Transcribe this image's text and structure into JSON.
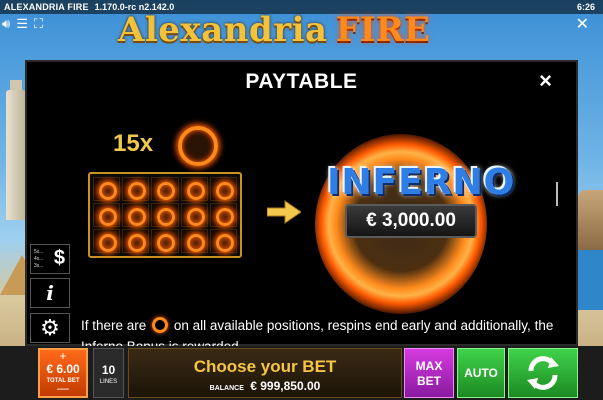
{
  "topbar": {
    "game_name": "ALEXANDRIA FIRE",
    "version": "1.170.0-rc n2.142.0",
    "time": "6:26"
  },
  "icons": {
    "sound": "speaker-icon",
    "menu": "menu-icon",
    "fullscreen": "fullscreen-icon",
    "close": "close-icon"
  },
  "logo": {
    "part1": "Alexandria",
    "part2": "FIRE"
  },
  "paytable": {
    "title": "PAYTABLE",
    "close": "×",
    "count_label": "15x",
    "prize_name": "INFERNO",
    "prize_amount": "€ 3,000.00",
    "desc_part1": "If there are",
    "desc_part2": "on all available positions, respins end early and additionally,",
    "desc_part3": "the Inferno Bonus is rewarded."
  },
  "side_buttons": {
    "paytable_lines": [
      "5x...",
      "4x...",
      "3x..."
    ],
    "paytable_symbol": "$",
    "info_symbol": "i",
    "settings_symbol": "⚙"
  },
  "bottom": {
    "bet_plus": "+",
    "bet_value": "€ 6.00",
    "bet_label": "TOTAL BET",
    "bet_minus": "—",
    "lines_value": "10",
    "lines_label": "LINES",
    "message": "Choose your BET",
    "balance_label": "BALANCE",
    "balance_value": "€ 999,850.00",
    "maxbet_label1": "MAX",
    "maxbet_label2": "BET",
    "auto_label": "AUTO"
  },
  "colors": {
    "accent_gold": "#f2c94c",
    "fire_orange": "#ff8a1c",
    "maxbet_purple": "#c22ed4",
    "spin_green": "#2fb83a",
    "inferno_blue": "#2f7ee6"
  }
}
